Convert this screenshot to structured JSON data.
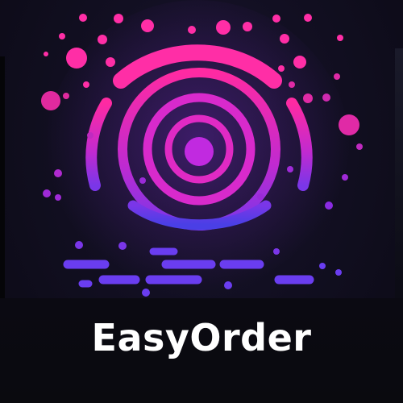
{
  "brand": {
    "name": "EasyOrder"
  },
  "logo": {
    "icon": "wireless-signal-emblem-icon",
    "colors": {
      "pink": "#ff2ea6",
      "magenta": "#c92ad8",
      "purple": "#8a2be2",
      "violet": "#6a3df0",
      "background": "#0b0a14",
      "text": "#ffffff"
    }
  }
}
